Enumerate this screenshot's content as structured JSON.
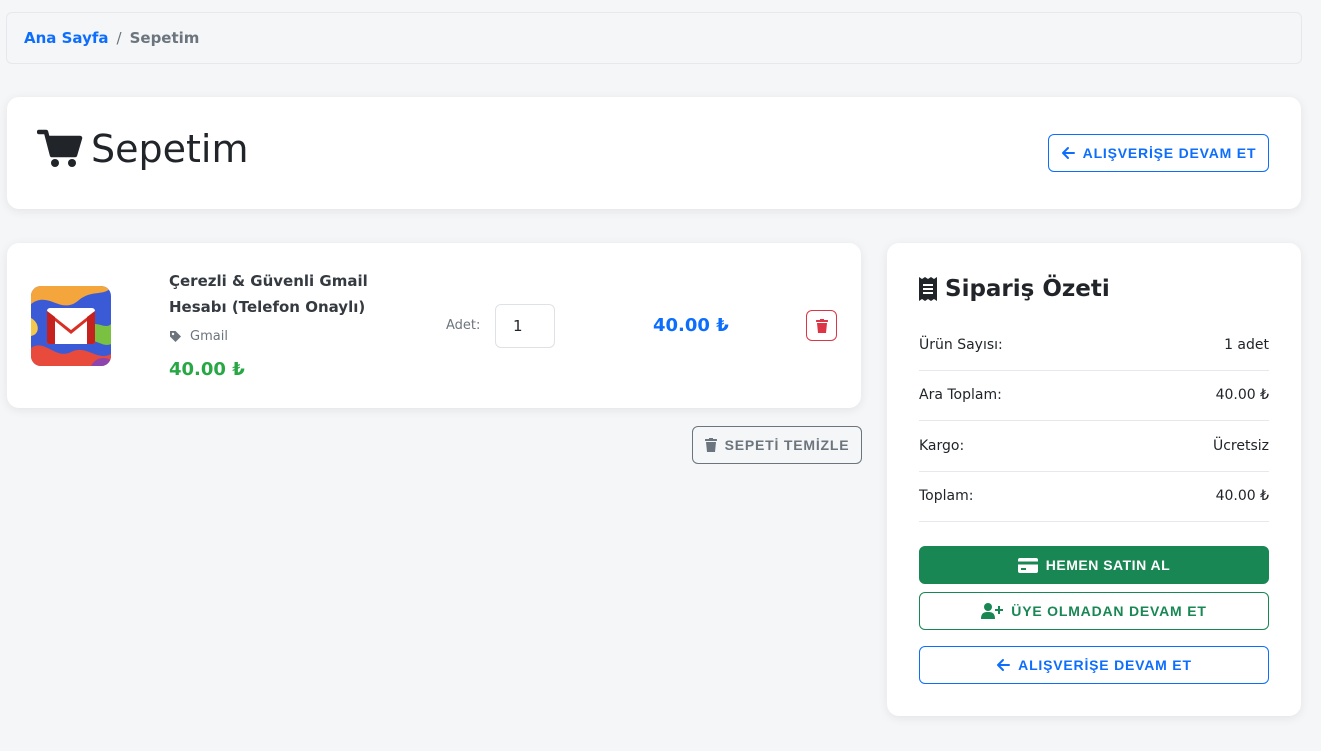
{
  "breadcrumb": {
    "home": "Ana Sayfa",
    "separator": "/",
    "current": "Sepetim"
  },
  "header": {
    "title": "Sepetim",
    "continue_label": "ALIŞVERİŞE DEVAM ET"
  },
  "cart": {
    "items": [
      {
        "name": "Çerezli & Güvenli Gmail Hesabı (Telefon Onaylı)",
        "category": "Gmail",
        "price": "40.00 ₺",
        "qty_label": "Adet:",
        "qty": "1",
        "line_total": "40.00 ₺"
      }
    ],
    "clear_label": "SEPETİ TEMİZLE"
  },
  "summary": {
    "title": "Sipariş Özeti",
    "rows": [
      {
        "label": "Ürün Sayısı:",
        "value": "1 adet"
      },
      {
        "label": "Ara Toplam:",
        "value": "40.00 ₺"
      },
      {
        "label": "Kargo:",
        "value": "Ücretsiz"
      },
      {
        "label": "Toplam:",
        "value": "40.00 ₺"
      }
    ],
    "buy_label": "HEMEN SATIN AL",
    "guest_label": "ÜYE OLMADAN DEVAM ET",
    "continue_label": "ALIŞVERİŞE DEVAM ET"
  },
  "colors": {
    "primary": "#0d6efd",
    "success": "#198754",
    "price_green": "#28a745",
    "danger": "#dc3545",
    "secondary": "#6c757d"
  },
  "icons": [
    "cart-icon",
    "arrow-left-icon",
    "tag-icon",
    "trash-icon",
    "receipt-icon",
    "credit-card-icon",
    "user-plus-icon",
    "gmail-logo"
  ]
}
